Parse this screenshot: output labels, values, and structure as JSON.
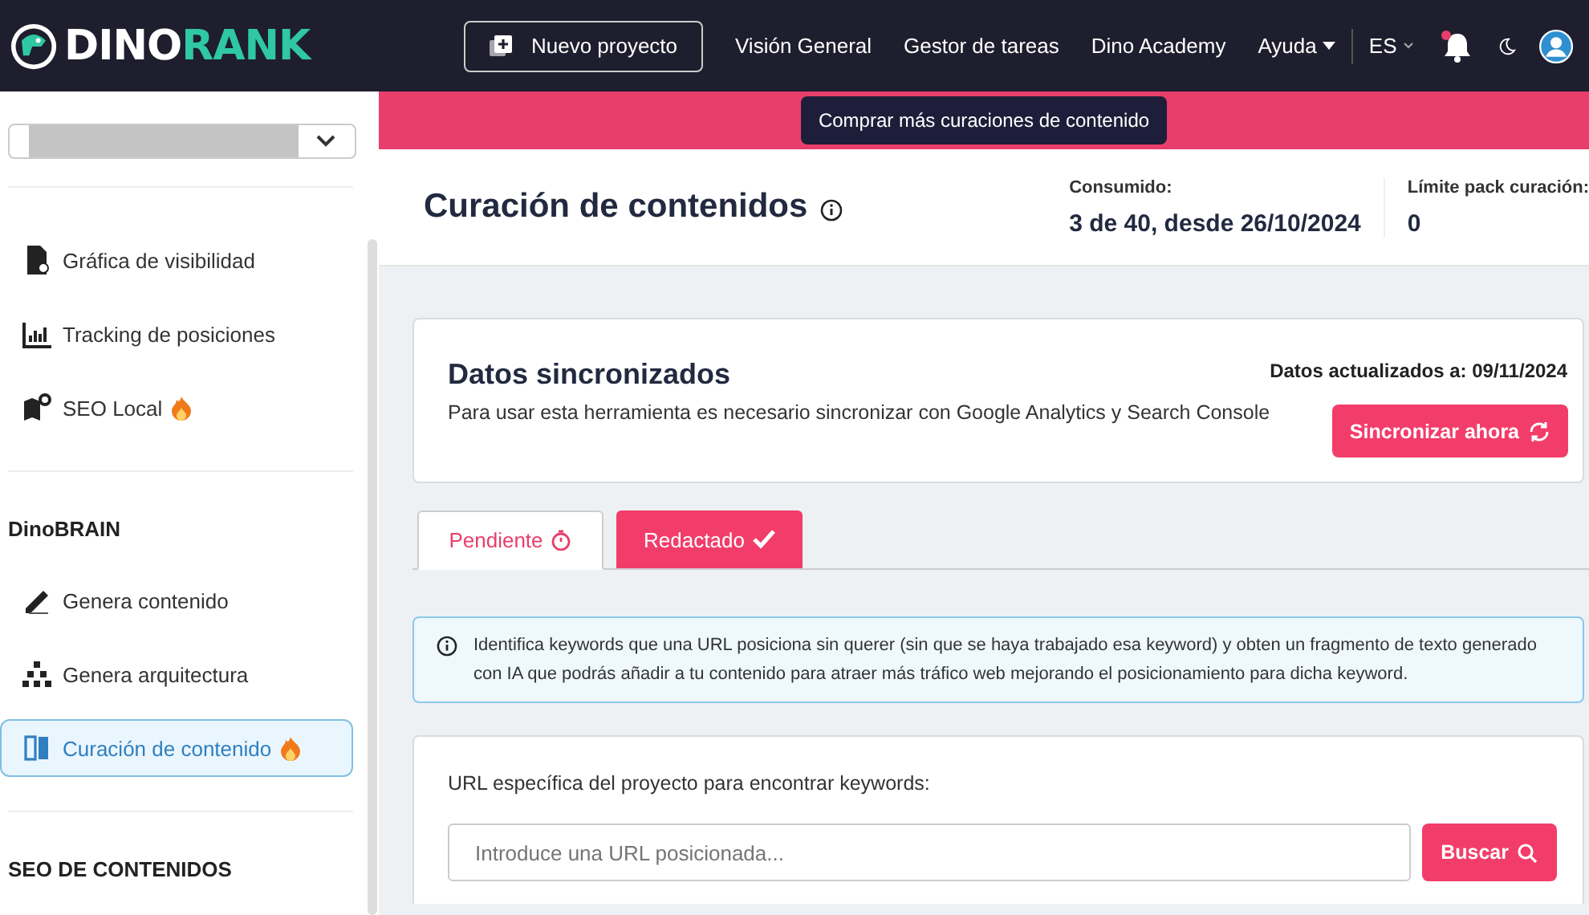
{
  "header": {
    "logo": [
      "DINO",
      "RANK"
    ],
    "new_project_button": "Nuevo proyecto",
    "nav": [
      {
        "label": "Visión General",
        "dropdown": false
      },
      {
        "label": "Gestor de tareas",
        "dropdown": false
      },
      {
        "label": "Dino Academy",
        "dropdown": false
      },
      {
        "label": "Ayuda",
        "dropdown": true
      }
    ],
    "language": "ES",
    "notification_dot": true
  },
  "sidebar": {
    "sections": [
      {
        "items": [
          {
            "label": "Gráfica de visibilidad",
            "kind": "doc",
            "hot": false,
            "selected": false
          },
          {
            "label": "Tracking de posiciones",
            "kind": "chart",
            "hot": false,
            "selected": false
          },
          {
            "label": "SEO Local",
            "kind": "map",
            "hot": true,
            "selected": false
          }
        ]
      },
      {
        "title": "DinoBRAIN",
        "items": [
          {
            "label": "Genera contenido",
            "kind": "pencil",
            "hot": false,
            "selected": false
          },
          {
            "label": "Genera arquitectura",
            "kind": "tree",
            "hot": false,
            "selected": false
          },
          {
            "label": "Curación de contenido",
            "kind": "book",
            "hot": true,
            "selected": true
          }
        ]
      },
      {
        "title": "SEO DE CONTENIDOS"
      }
    ]
  },
  "banner": {
    "button": "Comprar más curaciones de contenido"
  },
  "page_header": {
    "title": "Curación de contenidos",
    "stats": [
      {
        "label": "Consumido:",
        "value": "3 de 40, desde 26/10/2024"
      },
      {
        "label": "Límite pack curación:",
        "value": "0"
      }
    ]
  },
  "sync_card": {
    "title": "Datos sincronizados",
    "description": "Para usar esta herramienta es necesario sincronizar con Google Analytics y Search Console",
    "updated": "Datos actualizados a: 09/11/2024",
    "button": "Sincronizar ahora"
  },
  "tabs": [
    {
      "label": "Pendiente",
      "kind": "timer",
      "selected": true
    },
    {
      "label": "Redactado",
      "kind": "check",
      "selected": false
    }
  ],
  "info": "Identifica keywords que una URL posiciona sin querer (sin que se haya trabajado esa keyword) y obten un fragmento de texto generado con IA que podrás añadir a tu contenido para atraer más tráfico web mejorando el posicionamiento para dicha keyword.",
  "url_form": {
    "label": "URL específica del proyecto para encontrar keywords:",
    "placeholder": "Introduce una URL posicionada...",
    "button": "Buscar"
  }
}
